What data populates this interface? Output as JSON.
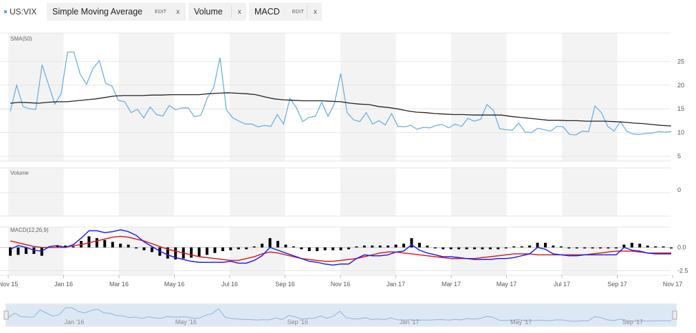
{
  "toolbar": {
    "symbol": "US:VIX",
    "studies": [
      {
        "label": "Simple Moving Average",
        "edit": "EDIT",
        "close": "x"
      },
      {
        "label": "Volume",
        "close": "x"
      },
      {
        "label": "MACD",
        "edit": "EDIT",
        "close": "x"
      }
    ]
  },
  "colors": {
    "price": "#6ab0e6",
    "sma": "#222222",
    "macd_line": "#1f1fff",
    "signal_line": "#e01c1c",
    "histogram": "#000000",
    "band": "#f3f3f3",
    "navigator_fill": "#dde8f5"
  },
  "chart_data": [
    {
      "type": "line",
      "panel_label": "SMA(50)",
      "x_tick_labels": [
        "Nov 15",
        "Jan 16",
        "Mar 16",
        "May 16",
        "Jul 16",
        "Sep 16",
        "Nov 16",
        "Jan 17",
        "Mar 17",
        "May 17",
        "Jul 17",
        "Sep 17",
        "Nov 17"
      ],
      "ylim": [
        4,
        31
      ],
      "y_ticks": [
        5,
        10,
        15,
        20,
        25
      ],
      "series": [
        {
          "key": "price",
          "values": [
            14.5,
            20.0,
            15.5,
            15.0,
            14.9,
            24.3,
            20.2,
            16.0,
            18.2,
            27.0,
            27.0,
            22.3,
            20.2,
            23.5,
            25.2,
            20.4,
            19.8,
            16.8,
            16.5,
            14.2,
            14.9,
            13.1,
            15.4,
            13.8,
            13.5,
            15.7,
            14.8,
            15.2,
            15.2,
            13.3,
            13.7,
            17.3,
            19.5,
            25.8,
            14.8,
            13.1,
            12.4,
            11.8,
            11.8,
            11.2,
            11.5,
            11.3,
            13.8,
            11.8,
            17.2,
            15.3,
            12.3,
            13.2,
            13.4,
            16.4,
            13.4,
            16.1,
            22.5,
            14.2,
            12.7,
            12.3,
            14.2,
            11.8,
            12.5,
            11.6,
            14.0,
            11.3,
            11.2,
            11.5,
            10.7,
            11.1,
            11.0,
            11.5,
            11.7,
            11.0,
            11.8,
            11.3,
            13.0,
            12.4,
            12.8,
            15.9,
            14.7,
            10.8,
            10.6,
            10.5,
            12.0,
            10.1,
            10.0,
            10.9,
            10.6,
            10.3,
            11.3,
            11.2,
            9.6,
            9.5,
            10.3,
            10.2,
            15.6,
            14.2,
            11.3,
            10.3,
            12.3,
            10.3,
            9.7,
            9.6,
            9.8,
            9.9,
            10.2,
            10.1,
            10.2
          ]
        },
        {
          "key": "sma",
          "values": [
            16.2,
            16.4,
            16.3,
            16.2,
            16.4,
            16.5,
            16.5,
            16.7,
            16.9,
            17.1,
            17.4,
            17.7,
            17.8,
            17.8,
            17.8,
            17.9,
            17.9,
            18.0,
            18.0,
            18.0,
            18.0,
            18.2,
            18.3,
            18.4,
            18.3,
            18.2,
            18.0,
            17.5,
            17.1,
            16.9,
            16.8,
            16.7,
            16.7,
            16.7,
            16.6,
            16.5,
            16.2,
            16.0,
            15.9,
            15.5,
            15.3,
            15.0,
            14.6,
            14.3,
            14.2,
            14.0,
            13.9,
            13.8,
            13.8,
            13.7,
            13.7,
            13.7,
            13.7,
            13.4,
            13.2,
            13.0,
            12.8,
            12.6,
            12.6,
            12.5,
            12.5,
            12.4,
            12.4,
            12.4,
            12.3,
            12.2,
            12.0,
            11.9,
            11.7,
            11.5,
            11.4
          ]
        }
      ]
    },
    {
      "type": "bar",
      "panel_label": "Volume",
      "y_ticks": [
        0
      ],
      "values": []
    },
    {
      "type": "line",
      "panel_label": "MACD(12,26,9)",
      "ylim": [
        -3.0,
        2.2
      ],
      "y_ticks": [
        0.0,
        -2.5
      ],
      "y_tick_labels": [
        "0.0",
        "-2.5"
      ],
      "series": [
        {
          "key": "macd_line",
          "values": [
            -0.2,
            0.2,
            0.0,
            -0.3,
            -0.4,
            0.1,
            0.2,
            0.0,
            0.3,
            1.0,
            1.8,
            1.8,
            1.6,
            1.7,
            1.9,
            1.7,
            1.3,
            0.6,
            0.1,
            -0.4,
            -0.8,
            -1.1,
            -1.3,
            -1.5,
            -1.6,
            -1.6,
            -1.6,
            -1.6,
            -1.5,
            -1.7,
            -1.7,
            -1.4,
            -0.9,
            0.0,
            -0.3,
            -0.6,
            -0.9,
            -1.2,
            -1.5,
            -1.6,
            -1.8,
            -1.9,
            -1.8,
            -1.8,
            -1.2,
            -0.8,
            -0.9,
            -0.9,
            -0.8,
            -0.5,
            -0.4,
            0.3,
            -0.3,
            -0.6,
            -0.8,
            -1.0,
            -1.0,
            -1.1,
            -1.2,
            -1.3,
            -1.3,
            -1.3,
            -1.2,
            -1.2,
            -1.1,
            -0.9,
            -0.7,
            0.0,
            -0.2,
            -0.7,
            -0.8,
            -0.9,
            -0.9,
            -0.8,
            -0.8,
            -0.8,
            -0.8,
            -0.8,
            0.0,
            -0.3,
            -0.4,
            -0.6,
            -0.7,
            -0.7,
            -0.7
          ]
        },
        {
          "key": "signal_line",
          "values": [
            0.7,
            0.5,
            0.3,
            0.1,
            0.0,
            0.0,
            0.0,
            0.0,
            0.2,
            0.3,
            0.5,
            0.7,
            0.9,
            1.1,
            1.2,
            1.1,
            0.9,
            0.7,
            0.4,
            0.1,
            -0.2,
            -0.4,
            -0.6,
            -0.8,
            -1.0,
            -1.1,
            -1.2,
            -1.3,
            -1.4,
            -1.4,
            -1.2,
            -1.0,
            -0.7,
            -0.5,
            -0.6,
            -0.8,
            -1.0,
            -1.2,
            -1.3,
            -1.4,
            -1.5,
            -1.5,
            -1.4,
            -1.3,
            -1.2,
            -1.0,
            -0.8,
            -0.6,
            -0.5,
            -0.5,
            -0.6,
            -0.7,
            -0.8,
            -0.9,
            -1.0,
            -1.1,
            -1.2,
            -1.2,
            -1.2,
            -1.2,
            -1.1,
            -1.0,
            -0.9,
            -0.8,
            -0.7,
            -0.7,
            -0.7,
            -0.8,
            -0.8,
            -0.8,
            -0.8,
            -0.8,
            -0.8,
            -0.8,
            -0.7,
            -0.6,
            -0.5,
            -0.4,
            -0.4,
            -0.4,
            -0.5,
            -0.6,
            -0.6,
            -0.6,
            -0.6
          ]
        },
        {
          "key": "histogram",
          "values": [
            -0.9,
            -0.8,
            -0.7,
            -0.7,
            -0.9,
            0.1,
            0.2,
            0.2,
            0.1,
            0.7,
            1.2,
            1.0,
            0.8,
            0.6,
            0.4,
            0.3,
            -0.1,
            -0.3,
            -0.5,
            -0.9,
            -1.2,
            -1.3,
            -1.2,
            -1.1,
            -1.0,
            -0.8,
            -0.6,
            -0.4,
            -0.3,
            -0.2,
            -0.2,
            0.1,
            0.4,
            1.0,
            0.7,
            0.3,
            0.0,
            -0.2,
            -0.4,
            -0.4,
            -0.3,
            -0.3,
            -0.3,
            -0.2,
            0.0,
            0.2,
            0.2,
            0.2,
            0.2,
            0.3,
            0.4,
            1.0,
            0.5,
            0.2,
            -0.1,
            -0.2,
            -0.2,
            -0.2,
            -0.2,
            -0.2,
            -0.2,
            -0.2,
            -0.2,
            -0.1,
            0.0,
            0.1,
            0.2,
            0.5,
            0.5,
            0.2,
            0.0,
            -0.1,
            -0.1,
            -0.1,
            -0.1,
            -0.1,
            -0.1,
            -0.1,
            0.3,
            0.5,
            0.4,
            0.2,
            0.1,
            0.0,
            -0.1
          ]
        }
      ]
    }
  ],
  "navigator": {
    "labels": [
      "Jan '16",
      "May '16",
      "Sep '16",
      "Jan '17",
      "May '17",
      "Sep '17"
    ]
  }
}
